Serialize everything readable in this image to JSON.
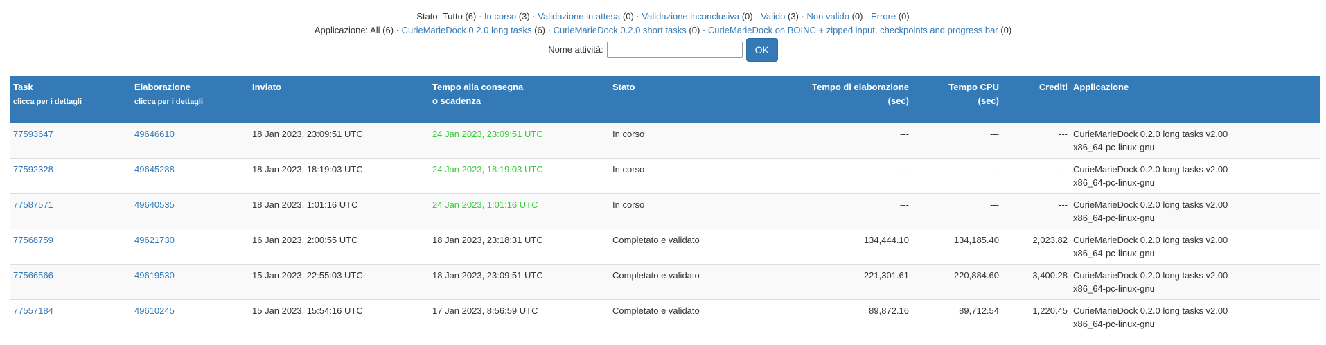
{
  "filters": {
    "stato_label": "Stato:",
    "stato_items": [
      {
        "label": "Tutto",
        "count": "(6)",
        "link": false
      },
      {
        "label": "In corso",
        "count": "(3)",
        "link": true
      },
      {
        "label": "Validazione in attesa",
        "count": "(0)",
        "link": true
      },
      {
        "label": "Validazione inconclusiva",
        "count": "(0)",
        "link": true
      },
      {
        "label": "Valido",
        "count": "(3)",
        "link": true
      },
      {
        "label": "Non valido",
        "count": "(0)",
        "link": true
      },
      {
        "label": "Errore",
        "count": "(0)",
        "link": true
      }
    ],
    "app_label": "Applicazione:",
    "app_items": [
      {
        "label": "All",
        "count": "(6)",
        "link": false
      },
      {
        "label": "CurieMarieDock 0.2.0 long tasks",
        "count": "(6)",
        "link": true
      },
      {
        "label": "CurieMarieDock 0.2.0 short tasks",
        "count": "(0)",
        "link": true
      },
      {
        "label": "CurieMarieDock on BOINC + zipped input, checkpoints and progress bar",
        "count": "(0)",
        "link": true
      }
    ],
    "separator": "·"
  },
  "search": {
    "label": "Nome attività:",
    "value": "",
    "button": "OK"
  },
  "table": {
    "headers": {
      "task": "Task",
      "task_sub": "clicca per i dettagli",
      "elab": "Elaborazione",
      "elab_sub": "clicca per i dettagli",
      "inviato": "Inviato",
      "tempo1": "Tempo alla consegna",
      "tempo2": "o scadenza",
      "stato": "Stato",
      "elab_time1": "Tempo di elaborazione",
      "elab_time2": "(sec)",
      "cpu1": "Tempo CPU",
      "cpu2": "(sec)",
      "crediti": "Crediti",
      "app": "Applicazione"
    },
    "rows": [
      {
        "task": "77593647",
        "workunit": "49646610",
        "sent": "18 Jan 2023, 23:09:51 UTC",
        "deadline": "24 Jan 2023, 23:09:51 UTC",
        "deadline_pending": true,
        "status": "In corso",
        "run_time": "---",
        "cpu_time": "---",
        "credit": "---",
        "app1": "CurieMarieDock 0.2.0 long tasks v2.00",
        "app2": "x86_64-pc-linux-gnu"
      },
      {
        "task": "77592328",
        "workunit": "49645288",
        "sent": "18 Jan 2023, 18:19:03 UTC",
        "deadline": "24 Jan 2023, 18:19:03 UTC",
        "deadline_pending": true,
        "status": "In corso",
        "run_time": "---",
        "cpu_time": "---",
        "credit": "---",
        "app1": "CurieMarieDock 0.2.0 long tasks v2.00",
        "app2": "x86_64-pc-linux-gnu"
      },
      {
        "task": "77587571",
        "workunit": "49640535",
        "sent": "18 Jan 2023, 1:01:16 UTC",
        "deadline": "24 Jan 2023, 1:01:16 UTC",
        "deadline_pending": true,
        "status": "In corso",
        "run_time": "---",
        "cpu_time": "---",
        "credit": "---",
        "app1": "CurieMarieDock 0.2.0 long tasks v2.00",
        "app2": "x86_64-pc-linux-gnu"
      },
      {
        "task": "77568759",
        "workunit": "49621730",
        "sent": "16 Jan 2023, 2:00:55 UTC",
        "deadline": "18 Jan 2023, 23:18:31 UTC",
        "deadline_pending": false,
        "status": "Completato e validato",
        "run_time": "134,444.10",
        "cpu_time": "134,185.40",
        "credit": "2,023.82",
        "app1": "CurieMarieDock 0.2.0 long tasks v2.00",
        "app2": "x86_64-pc-linux-gnu"
      },
      {
        "task": "77566566",
        "workunit": "49619530",
        "sent": "15 Jan 2023, 22:55:03 UTC",
        "deadline": "18 Jan 2023, 23:09:51 UTC",
        "deadline_pending": false,
        "status": "Completato e validato",
        "run_time": "221,301.61",
        "cpu_time": "220,884.60",
        "credit": "3,400.28",
        "app1": "CurieMarieDock 0.2.0 long tasks v2.00",
        "app2": "x86_64-pc-linux-gnu"
      },
      {
        "task": "77557184",
        "workunit": "49610245",
        "sent": "15 Jan 2023, 15:54:16 UTC",
        "deadline": "17 Jan 2023, 8:56:59 UTC",
        "deadline_pending": false,
        "status": "Completato e validato",
        "run_time": "89,872.16",
        "cpu_time": "89,712.54",
        "credit": "1,220.45",
        "app1": "CurieMarieDock 0.2.0 long tasks v2.00",
        "app2": "x86_64-pc-linux-gnu"
      }
    ]
  }
}
